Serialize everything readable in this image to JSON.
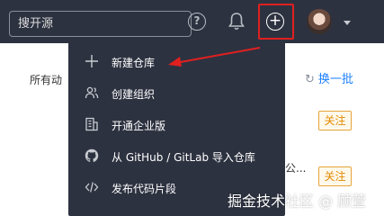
{
  "topbar": {
    "search": {
      "placeholder": "搜开源",
      "value": ""
    },
    "help_icon": "question-circle-icon",
    "bell_icon": "bell-icon",
    "create_icon": "plus-circle-icon",
    "avatar": "user-avatar",
    "caret_icon": "caret-down-icon"
  },
  "menu": {
    "items": [
      {
        "label": "新建仓库",
        "icon": "plus-icon"
      },
      {
        "label": "创建组织",
        "icon": "users-icon"
      },
      {
        "label": "开通企业版",
        "icon": "building-icon"
      },
      {
        "label": "从 GitHub / GitLab 导入仓库",
        "icon": "github-icon"
      },
      {
        "label": "发布代码片段",
        "icon": "code-icon"
      }
    ]
  },
  "background": {
    "feed_label": "所有动",
    "refresh_label": "换一批",
    "follow_label_1": "关注",
    "follow_label_2": "关注",
    "partial_text": "公..."
  },
  "watermark": "掘金技术社区 @ 顾萱",
  "colors": {
    "topbar": "#2d3240",
    "highlight": "#e02020",
    "follow": "#e08a00",
    "link": "#1e80ff"
  }
}
